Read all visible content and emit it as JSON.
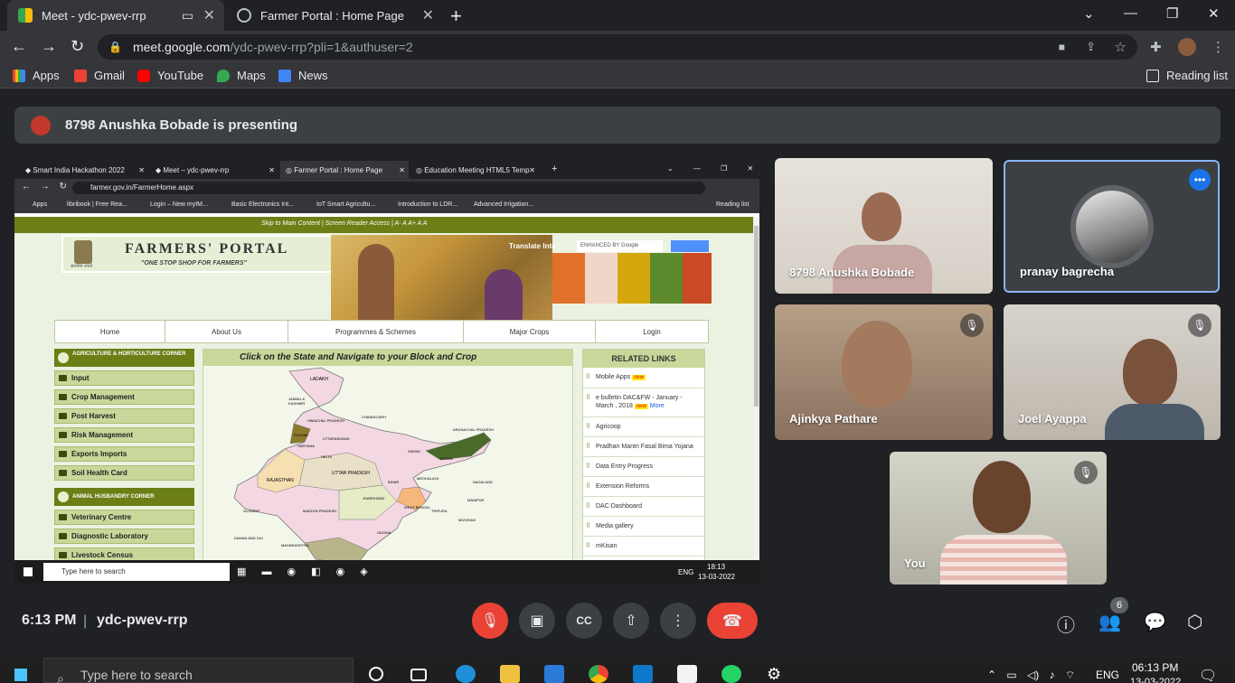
{
  "browser": {
    "tabs": [
      {
        "title": "Meet - ydc-pwev-rrp",
        "active": true
      },
      {
        "title": "Farmer Portal : Home Page",
        "active": false
      }
    ],
    "new_tab": "+",
    "window_controls": {
      "minimize": "⌄",
      "min": "—",
      "restore": "❐",
      "close": "✕"
    },
    "url_host": "meet.google.com",
    "url_path": "/ydc-pwev-rrp?pli=1&authuser=2",
    "bookmarks": [
      "Apps",
      "Gmail",
      "YouTube",
      "Maps",
      "News"
    ],
    "reading_list": "Reading list"
  },
  "meet": {
    "presenting_text": "8798 Anushka Bobade is presenting",
    "time": "6:13 PM",
    "separator": "|",
    "meeting_code": "ydc-pwev-rrp",
    "participants_count": "6",
    "participants": [
      {
        "name": "8798 Anushka Bobade",
        "muted": false
      },
      {
        "name": "pranay bagrecha",
        "muted": false,
        "speaking": true
      },
      {
        "name": "Ajinkya Pathare",
        "muted": true
      },
      {
        "name": "Joel Ayappa",
        "muted": true
      },
      {
        "name": "You",
        "muted": true
      }
    ],
    "accent_color": "#8ab4f8",
    "hangup_color": "#ea4335"
  },
  "shared_screen": {
    "tabs": [
      "Smart India Hackathon 2022",
      "Meet – ydc-pwev-rrp",
      "Farmer Portal : Home Page",
      "Education Meeting HTML5 Temp"
    ],
    "url": "farmer.gov.in/FarmerHome.aspx",
    "bookmarks": [
      "Apps",
      "libribook | Free Rea...",
      "Login – New myIM...",
      "Basic Electronics Int...",
      "IoT Smart Agricultu...",
      "Introduction to LDR...",
      "Advanced Irrigation..."
    ],
    "reading_list": "Reading list",
    "top_links": "Skip to Main Content  |  Screen Reader Access  |  A-  A  A+  A  A",
    "portal_title": "FARMERS' PORTAL",
    "portal_subtitle": "\"ONE STOP SHOP FOR FARMERS\"",
    "emblem_text": "सत्यमेव जयते",
    "translate_label": "Translate Into :",
    "search_placeholder": "ENHANCED BY Google",
    "menu": [
      "Home",
      "About Us",
      "Programmes & Schemes",
      "Major Crops",
      "Login"
    ],
    "agri_corner_title": "AGRICULTURE & HORTICULTURE CORNER",
    "agri_items": [
      "Input",
      "Crop Management",
      "Post Harvest",
      "Risk Management",
      "Exports Imports",
      "Soil Health Card"
    ],
    "animal_corner_title": "ANIMAL HUSBANDRY CORNER",
    "animal_items": [
      "Veterinary Centre",
      "Diagnostic Laboratory",
      "Livestock Census"
    ],
    "map_heading": "Click on the State and Navigate to your Block and Crop",
    "map_labels": [
      "LADAKH",
      "JAMMU & KASHMIR",
      "HIMACHAL PRADESH",
      "PUNJAB",
      "CHANDIGARH",
      "UTTARAKHAND",
      "HARYANA",
      "DELHI",
      "RAJASTHAN",
      "UTTAR PRADESH",
      "SIKKIM",
      "ARUNACHAL PRADESH",
      "ASSAM",
      "NAGALAND",
      "MEGHALAYA",
      "MANIPUR",
      "BIHAR",
      "TRIPURA",
      "MIZORAM",
      "WEST BENGAL",
      "JHARKHAND",
      "GUJARAT",
      "MADHYA PRADESH",
      "ODISHA",
      "DAMAN AND DIU",
      "MAHARASHTRA"
    ],
    "related_title": "RELATED LINKS",
    "related": [
      {
        "text": "Mobile Apps",
        "new": true
      },
      {
        "text": "e bulletin DAC&FW - January - March , 2018",
        "new": true,
        "more": "More"
      },
      {
        "text": "Agricoop"
      },
      {
        "text": "Pradhan Mantri Fasal Bima Yojana"
      },
      {
        "text": "Data Entry Progress"
      },
      {
        "text": "Extension Reforms"
      },
      {
        "text": "DAC Dashboard"
      },
      {
        "text": "Media gallery"
      },
      {
        "text": "mKisan"
      }
    ],
    "new_badge": "new",
    "taskbar_search": "Type here to search",
    "taskbar_lang": "ENG",
    "taskbar_time": "18:13",
    "taskbar_date": "13-03-2022"
  },
  "windows_taskbar": {
    "search": "Type here to search",
    "lang": "ENG",
    "time": "06:13 PM",
    "date": "13-03-2022"
  }
}
